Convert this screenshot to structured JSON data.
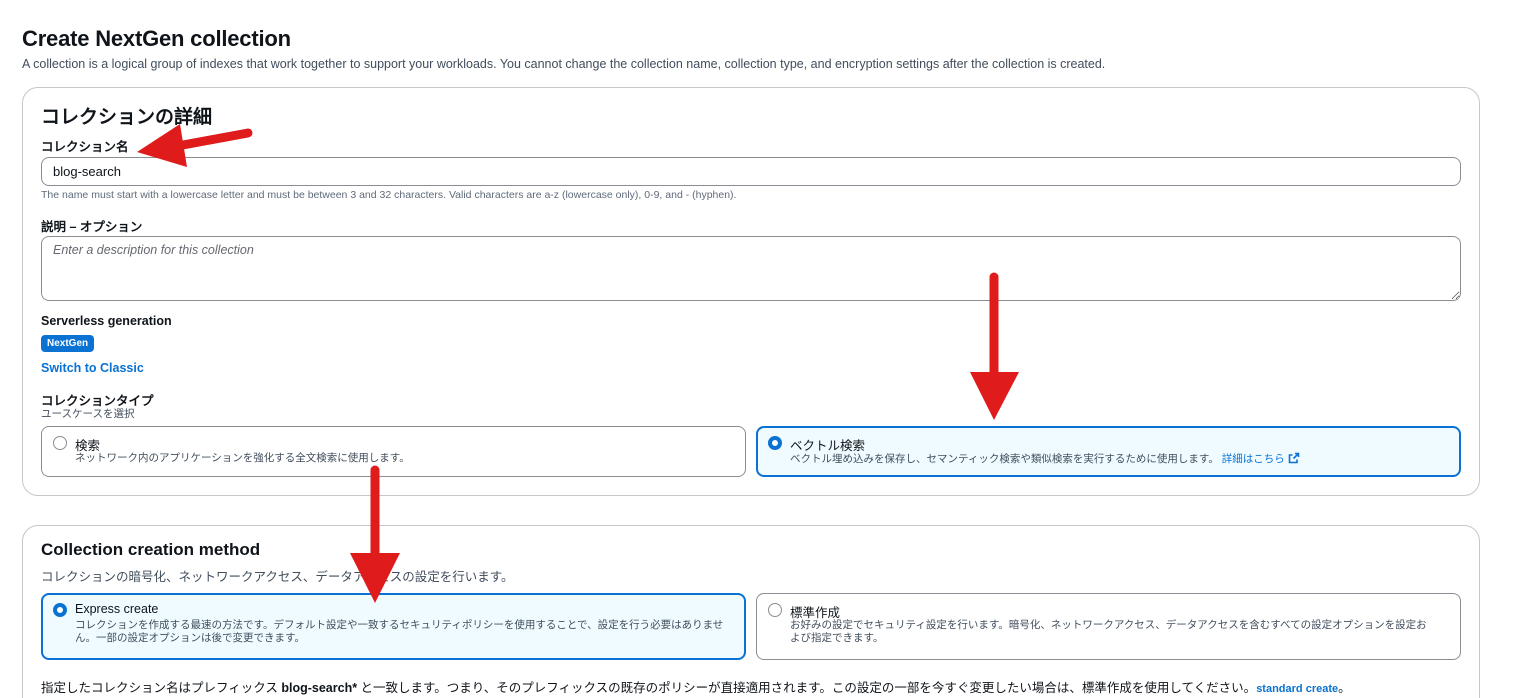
{
  "page": {
    "title": "Create NextGen collection",
    "description": "A collection is a logical group of indexes that work together to support your workloads. You cannot change the collection name, collection type, and encryption settings after the collection is created."
  },
  "details": {
    "title": "コレクションの詳細",
    "name_label": "コレクション名",
    "name_value": "blog-search",
    "name_hint": "The name must start with a lowercase letter and must be between 3 and 32 characters. Valid characters are a-z (lowercase only), 0-9, and - (hyphen).",
    "desc_label": "説明 – オプション",
    "desc_placeholder": "Enter a description for this collection",
    "generation_label": "Serverless generation",
    "generation_badge": "NextGen",
    "switch_link": "Switch to Classic",
    "type_label": "コレクションタイプ",
    "type_hint": "ユースケースを選択",
    "type_options": [
      {
        "title": "検索",
        "desc": "ネットワーク内のアプリケーションを強化する全文検索に使用します。",
        "selected": false
      },
      {
        "title": "ベクトル検索",
        "desc": "ベクトル埋め込みを保存し、セマンティック検索や類似検索を実行するために使用します。",
        "link": "詳細はこちら",
        "link_icon": "external-link-icon",
        "selected": true
      }
    ]
  },
  "method": {
    "title": "Collection creation method",
    "subtitle": "コレクションの暗号化、ネットワークアクセス、データアクセスの設定を行います。",
    "options": [
      {
        "title": "Express create",
        "desc_line1": "コレクションを作成する最速の方法です。デフォルト設定や一致するセキュリティポリシーを使用することで、設定を行う必要はありませ",
        "desc_line2": "ん。一部の設定オプションは後で変更できます。",
        "selected": true
      },
      {
        "title": "標準作成",
        "desc_line1": "お好みの設定でセキュリティ設定を行います。暗号化、ネットワークアクセス、データアクセスを含むすべての設定オプションを設定お",
        "desc_line2": "よび指定できます。",
        "selected": false
      }
    ],
    "note_before": "指定したコレクション名はプレフィックス ",
    "note_bold": "blog-search*",
    "note_after": " と一致します。つまり、そのプレフィックスの既存のポリシーが直接適用されます。この設定の一部を今すぐ変更したい場合は、標準作成を使用してください。",
    "note_link": "standard create",
    "note_end": "。"
  },
  "colors": {
    "accent": "#0972d3",
    "annotation_arrow": "#e01b1b",
    "selected_bg": "#f0fbff"
  }
}
